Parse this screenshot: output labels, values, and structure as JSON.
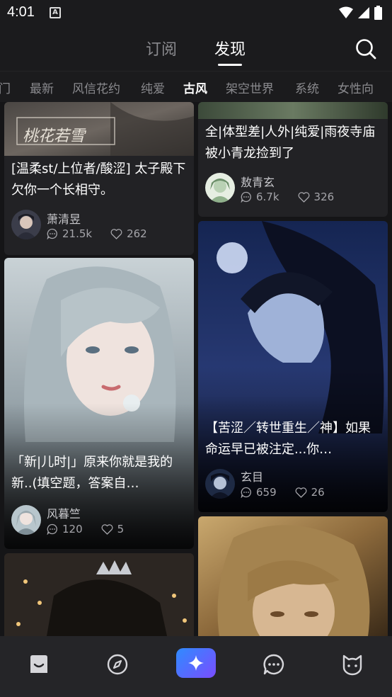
{
  "status_bar": {
    "time": "4:01",
    "notification_icon": "A"
  },
  "top_tabs": {
    "subscribe": "订阅",
    "discover": "发现"
  },
  "categories": [
    "门",
    "最新",
    "风信花约",
    "纯爱",
    "古风",
    "架空世界",
    "系统",
    "女性向"
  ],
  "active_category": "古风",
  "cards": [
    {
      "title": "[温柔st/上位者/酸涩] 太子殿下欠你一个长相守。",
      "author": "萧清昱",
      "comments": "21.5k",
      "likes": "262",
      "image_text": "桃花若雪"
    },
    {
      "title": "全|体型差|人外|纯爱|雨夜寺庙被小青龙捡到了",
      "author": "敖青玄",
      "comments": "6.7k",
      "likes": "326"
    },
    {
      "title": "「新|儿时|」原来你就是我的新..(填空题，答案自…",
      "author": "风暮竺",
      "comments": "120",
      "likes": "5"
    },
    {
      "title": "【苦涩／转世重生／神】如果命运早已被注定...你…",
      "author": "玄目",
      "comments": "659",
      "likes": "26"
    }
  ],
  "bottom_nav": [
    "home-icon",
    "compass-icon",
    "sparkle-icon",
    "chat-icon",
    "cat-icon"
  ],
  "colors": {
    "background": "#151517",
    "card": "#222225",
    "accent_start": "#2f8bff",
    "accent_end": "#7a4dff"
  }
}
